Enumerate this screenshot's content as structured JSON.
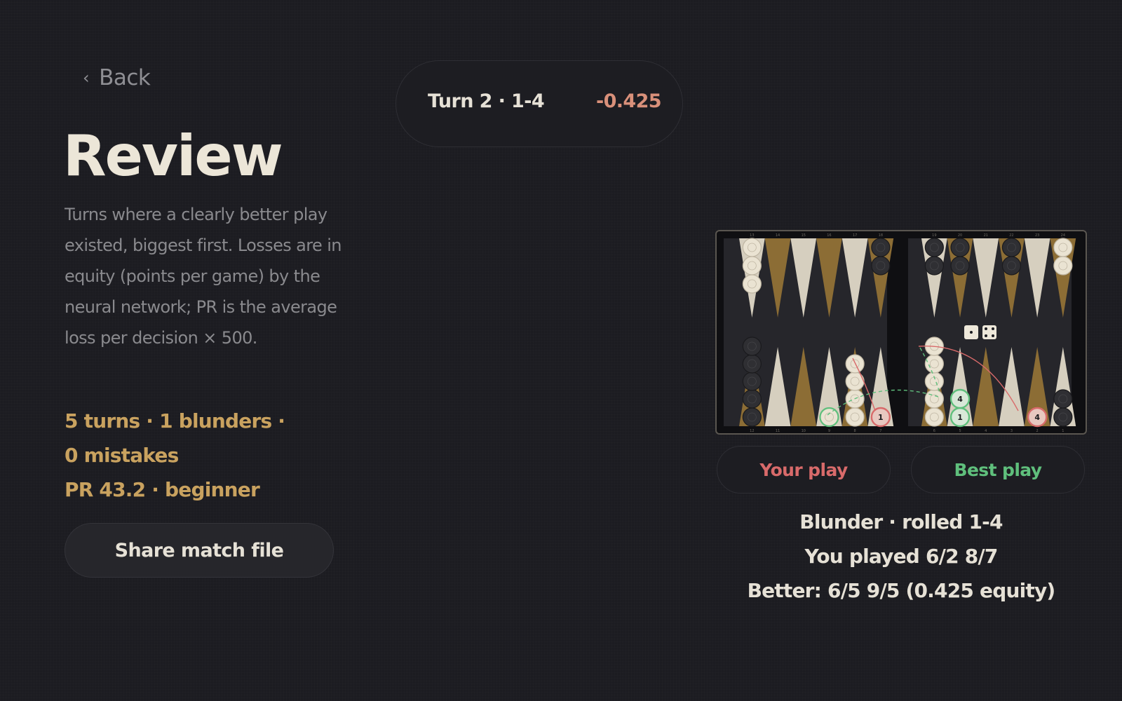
{
  "nav": {
    "back_label": "Back",
    "back_icon": "chevron-left-icon"
  },
  "page": {
    "title": "Review",
    "description": "Turns where a clearly better play existed, biggest first. Losses are in equity (points per game) by the neural network; PR is the average loss per decision × 500."
  },
  "summary": {
    "line1": "5 turns · 1 blunders · 0 mistakes",
    "line2": "PR 43.2 · beginner"
  },
  "share_button": {
    "label": "Share match file"
  },
  "turn_list": [
    {
      "label": "Turn 2 · 1-4",
      "loss": "-0.425"
    }
  ],
  "board": {
    "top_point_numbers": [
      "13",
      "14",
      "15",
      "16",
      "17",
      "18",
      "19",
      "20",
      "21",
      "22",
      "23",
      "24"
    ],
    "bottom_point_numbers": [
      "12",
      "11",
      "10",
      "9",
      "8",
      "7",
      "6",
      "5",
      "4",
      "3",
      "2",
      "1"
    ],
    "dice": [
      1,
      4
    ],
    "your_move_markers": [
      "1",
      "4"
    ],
    "best_move_markers": [
      "4",
      "1"
    ],
    "colors": {
      "frame": "#0f0f12",
      "felt": "#26262b",
      "gold_point": "#8c6d35",
      "light_point": "#d6cfbf",
      "white_checker": "#eae3d2",
      "black_checker": "#2f2f33",
      "your_play": "#d86a6a",
      "best_play": "#5fbf7c"
    }
  },
  "play_toggle": {
    "your_label": "Your play",
    "best_label": "Best play"
  },
  "verdict": {
    "line1": "Blunder · rolled 1-4",
    "line2": "You played 6/2 8/7",
    "line3": "Better: 6/5 9/5  (0.425 equity)"
  }
}
